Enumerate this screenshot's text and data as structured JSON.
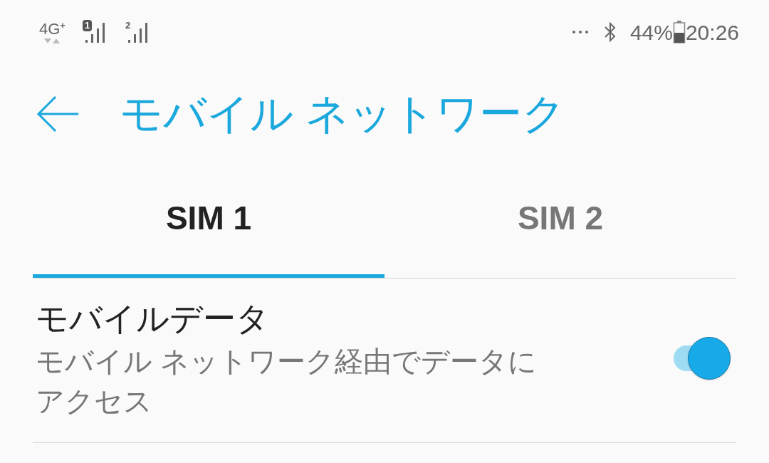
{
  "status_bar": {
    "network_type": "4G",
    "network_plus": "+",
    "sims": [
      {
        "label": "1",
        "highlighted": true
      },
      {
        "label": "2",
        "highlighted": false
      }
    ],
    "battery_percent": "44%",
    "time": "20:26"
  },
  "header": {
    "title": "モバイル ネットワーク"
  },
  "tabs": [
    {
      "label": "SIM 1",
      "selected": true
    },
    {
      "label": "SIM 2",
      "selected": false
    }
  ],
  "settings": [
    {
      "title": "モバイルデータ",
      "subtitle": "モバイル ネットワーク経由でデータにアクセス",
      "on": true
    }
  ]
}
